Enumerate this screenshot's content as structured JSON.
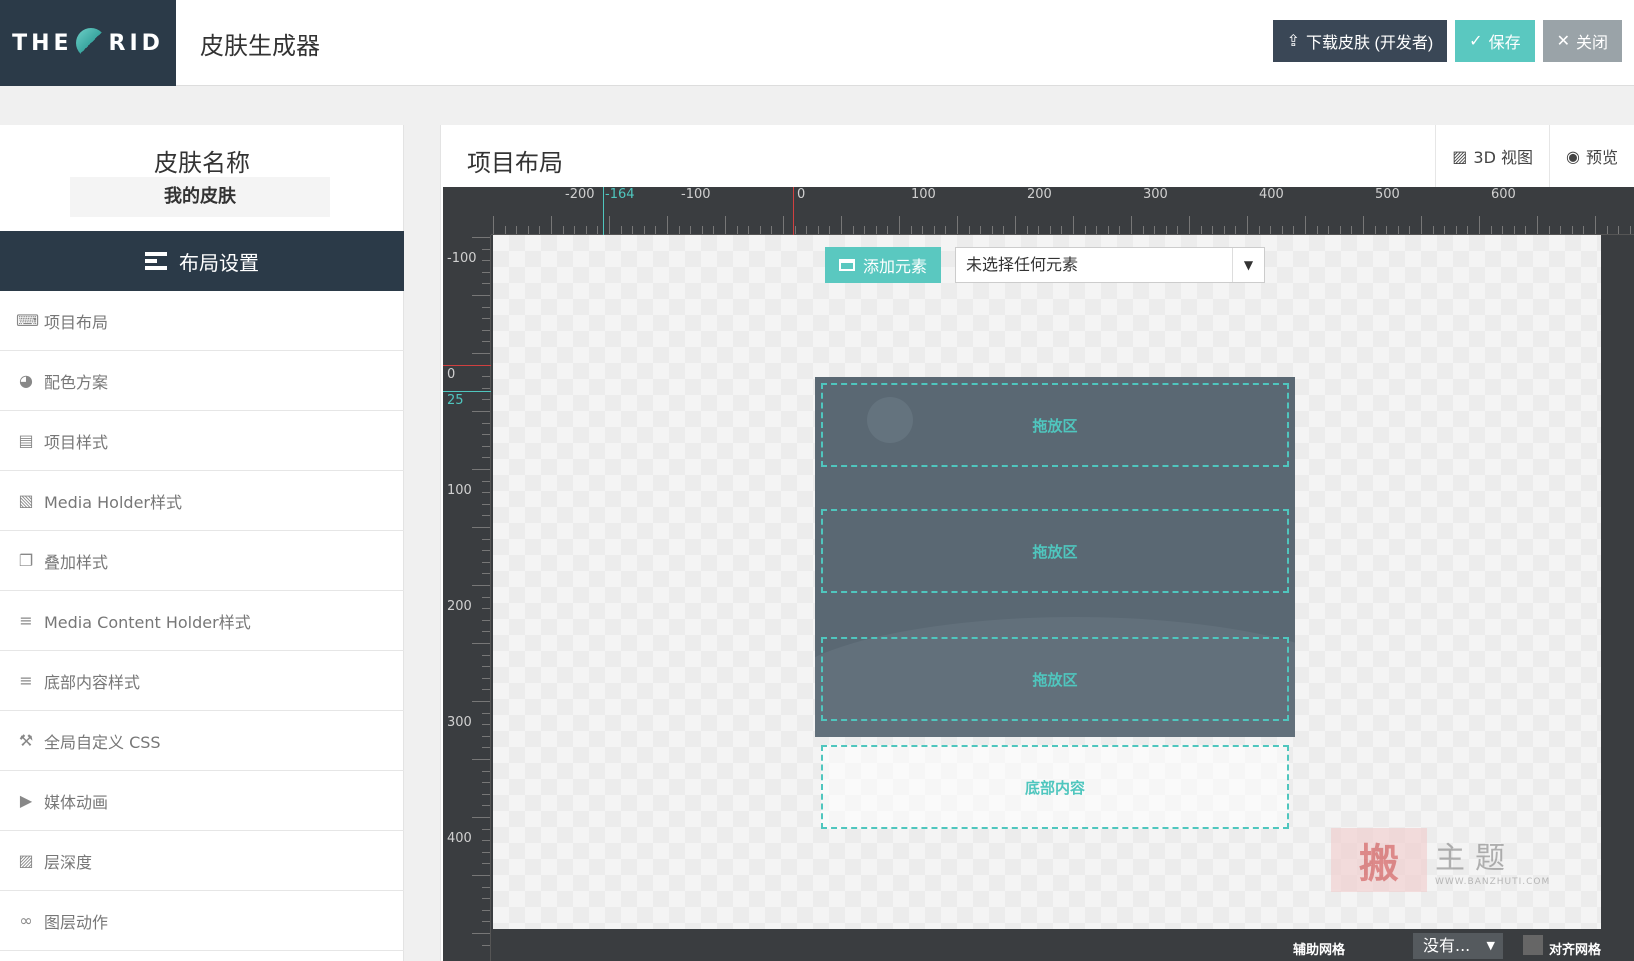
{
  "header": {
    "logo_left": "THE",
    "logo_right": "RID",
    "app_title": "皮肤生成器",
    "buttons": {
      "download": "下载皮肤 (开发者)",
      "save": "保存",
      "close": "关闭"
    }
  },
  "sidebar": {
    "skin_label": "皮肤名称",
    "skin_name": "我的皮肤",
    "section_title": "布局设置",
    "items": [
      {
        "label": "项目布局",
        "icon": "keyboard-icon"
      },
      {
        "label": "配色方案",
        "icon": "palette-icon"
      },
      {
        "label": "项目样式",
        "icon": "item-style-icon"
      },
      {
        "label": "Media Holder样式",
        "icon": "image-icon"
      },
      {
        "label": "叠加样式",
        "icon": "copy-icon"
      },
      {
        "label": "Media Content Holder样式",
        "icon": "list-icon"
      },
      {
        "label": "底部内容样式",
        "icon": "list-icon"
      },
      {
        "label": "全局自定义 CSS",
        "icon": "hammer-icon"
      },
      {
        "label": "媒体动画",
        "icon": "film-icon"
      },
      {
        "label": "层深度",
        "icon": "images-icon"
      },
      {
        "label": "图层动作",
        "icon": "link-icon"
      }
    ]
  },
  "main": {
    "title": "项目布局",
    "tools": {
      "view3d": "3D 视图",
      "preview": "预览"
    },
    "ruler_top": [
      "-200",
      "-164",
      "-100",
      "0",
      "100",
      "200",
      "300",
      "400",
      "500",
      "600"
    ],
    "ruler_left": [
      "-100",
      "0",
      "25",
      "100",
      "200",
      "300",
      "400"
    ],
    "add_element": "添加元素",
    "select_value": "未选择任何元素",
    "drop_zones": [
      "拖放区",
      "拖放区",
      "拖放区"
    ],
    "footer_zone": "底部内容",
    "bottom": {
      "grid_label": "辅助网格",
      "grid_value": "没有...",
      "snap_label": "对齐网格"
    }
  },
  "watermark": {
    "glyph": "搬",
    "text": "主题",
    "url": "WWW.BANZHUTI.COM"
  },
  "colors": {
    "accent": "#5ac8c0",
    "dark": "#2b3a48"
  }
}
